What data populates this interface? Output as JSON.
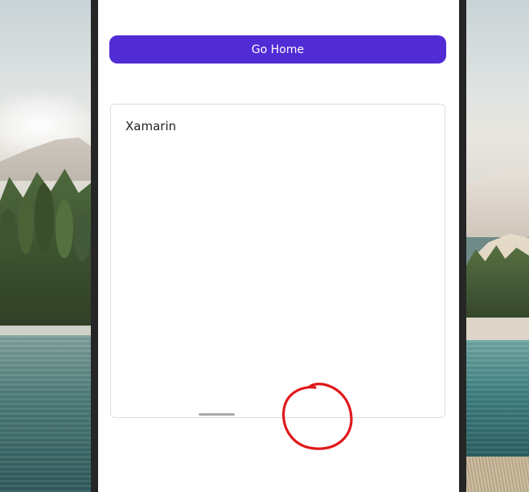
{
  "app": {
    "go_home_button_label": "Go Home",
    "editor_text": "Xamarin"
  },
  "colors": {
    "primary_button": "#512bd4",
    "annotation_circle": "#e0191b"
  }
}
